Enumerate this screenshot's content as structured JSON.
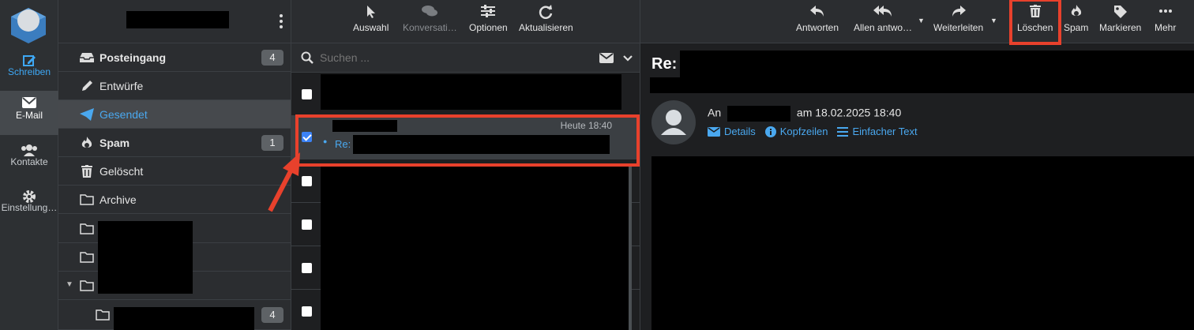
{
  "nav": {
    "items": [
      {
        "label": "Schreiben",
        "icon": "compose-icon"
      },
      {
        "label": "E-Mail",
        "icon": "envelope-icon"
      },
      {
        "label": "Kontakte",
        "icon": "contacts-icon"
      },
      {
        "label": "Einstellung…",
        "icon": "gear-icon"
      }
    ]
  },
  "folders": {
    "items": [
      {
        "name": "Posteingang",
        "count": "4",
        "icon": "inbox-icon"
      },
      {
        "name": "Entwürfe",
        "icon": "pencil-icon"
      },
      {
        "name": "Gesendet",
        "icon": "paper-plane-icon"
      },
      {
        "name": "Spam",
        "count": "1",
        "icon": "fire-icon"
      },
      {
        "name": "Gelöscht",
        "icon": "trash-icon"
      },
      {
        "name": "Archive",
        "icon": "folder-icon"
      }
    ],
    "subfolder_count": "4"
  },
  "list_toolbar": {
    "select": "Auswahl",
    "threads": "Konversati…",
    "options": "Optionen",
    "refresh": "Aktualisieren"
  },
  "search": {
    "placeholder": "Suchen ..."
  },
  "message_list": {
    "selected": {
      "time": "Heute 18:40",
      "subject_prefix": "Re:"
    }
  },
  "message_toolbar": {
    "reply": "Antworten",
    "reply_all": "Allen antwo…",
    "forward": "Weiterleiten",
    "delete": "Löschen",
    "spam": "Spam",
    "mark": "Markieren",
    "more": "Mehr"
  },
  "message": {
    "subject_prefix": "Re:",
    "to_label": "An",
    "date_text": "am 18.02.2025 18:40",
    "links": {
      "details": "Details",
      "headers": "Kopfzeilen",
      "plain": "Einfacher Text"
    }
  },
  "colors": {
    "accent": "#4aa8ef",
    "highlight": "#e8412c"
  }
}
